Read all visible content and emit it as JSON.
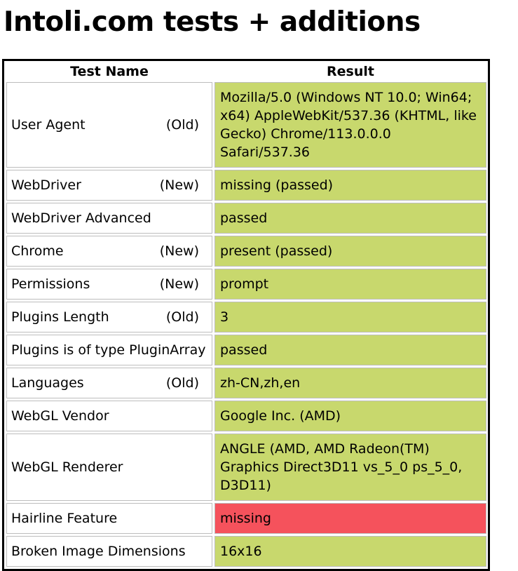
{
  "page": {
    "title": "Intoli.com tests + additions"
  },
  "table": {
    "headers": {
      "name": "Test Name",
      "result": "Result"
    },
    "rows": [
      {
        "name": "User Agent",
        "tag": "(Old)",
        "result": "Mozilla/5.0 (Windows NT 10.0; Win64; x64) AppleWebKit/537.36 (KHTML, like Gecko) Chrome/113.0.0.0 Safari/537.36",
        "status": "passed"
      },
      {
        "name": "WebDriver",
        "tag": "(New)",
        "result": "missing (passed)",
        "status": "passed"
      },
      {
        "name": "WebDriver Advanced",
        "tag": "",
        "result": "passed",
        "status": "passed"
      },
      {
        "name": "Chrome",
        "tag": "(New)",
        "result": "present (passed)",
        "status": "passed"
      },
      {
        "name": "Permissions",
        "tag": "(New)",
        "result": "prompt",
        "status": "passed"
      },
      {
        "name": "Plugins Length",
        "tag": "(Old)",
        "result": "3",
        "status": "passed"
      },
      {
        "name": "Plugins is of type PluginArray",
        "tag": "",
        "result": "passed",
        "status": "passed"
      },
      {
        "name": "Languages",
        "tag": "(Old)",
        "result": "zh-CN,zh,en",
        "status": "passed"
      },
      {
        "name": "WebGL Vendor",
        "tag": "",
        "result": "Google Inc. (AMD)",
        "status": "passed"
      },
      {
        "name": "WebGL Renderer",
        "tag": "",
        "result": "ANGLE (AMD, AMD Radeon(TM) Graphics Direct3D11 vs_5_0 ps_5_0, D3D11)",
        "status": "passed"
      },
      {
        "name": "Hairline Feature",
        "tag": "",
        "result": "missing",
        "status": "failed"
      },
      {
        "name": "Broken Image Dimensions",
        "tag": "",
        "result": "16x16",
        "status": "passed"
      }
    ]
  },
  "colors": {
    "passed": "#c8d86d",
    "failed": "#f5525c"
  }
}
